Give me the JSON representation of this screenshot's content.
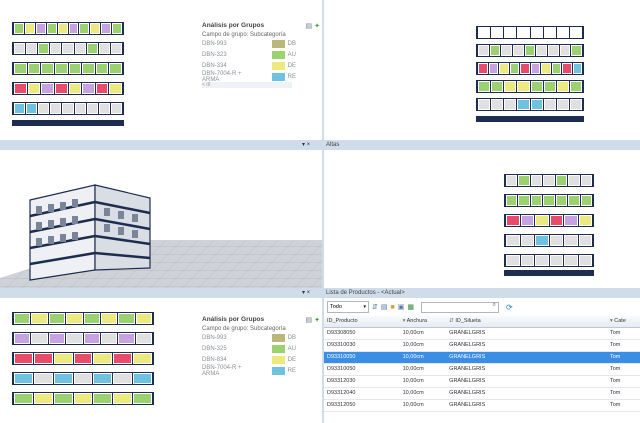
{
  "legend": {
    "title": "Análisis por Grupos",
    "subtitle": "Campo de grupo: Subcategoría",
    "items": [
      {
        "name": "DBN-993",
        "color": "#b9b77a",
        "code": "DB"
      },
      {
        "name": "DBN-323",
        "color": "#9bd16f",
        "code": "AU"
      },
      {
        "name": "DBN-334",
        "color": "#ecea7e",
        "code": "DE"
      },
      {
        "name": "DBN-7004-R + ARMA",
        "color": "#6fc1e0",
        "code": "RE"
      }
    ],
    "footer": "< III"
  },
  "legend_bottom": {
    "title": "Análisis por Grupos",
    "subtitle": "Campo de grupo: Subcategoría",
    "items": [
      {
        "name": "DBN-993",
        "color": "#b9b77a",
        "code": "DB"
      },
      {
        "name": "DBN-325",
        "color": "#9bd16f",
        "code": "AU"
      },
      {
        "name": "DBN-834",
        "color": "#ecea7e",
        "code": "DE"
      },
      {
        "name": "DBN-7004-R + ARMA",
        "color": "#6fc1e0",
        "code": "RE"
      }
    ]
  },
  "panel_alta": {
    "title": "Altas"
  },
  "product_list": {
    "title": "Lista de Productos - <Actual>",
    "filter_value": "Todo",
    "columns": [
      "ID_Producto",
      "Anchura",
      "ID_Silueta",
      "Cate"
    ],
    "rows": [
      [
        "D93308050",
        "10,00cm",
        "GRANELGRIS",
        "Tom"
      ],
      [
        "D93310030",
        "10,00cm",
        "GRANELGRIS",
        "Tom"
      ],
      [
        "D93310050",
        "10,00cm",
        "GRANELGRIS",
        "Tom"
      ],
      [
        "D93310050",
        "10,00cm",
        "GRANELGRIS",
        "Tom"
      ],
      [
        "D93312030",
        "10,00cm",
        "GRANELGRIS",
        "Tom"
      ],
      [
        "D93312040",
        "10,00cm",
        "GRANELGRIS",
        "Tom"
      ],
      [
        "D93312050",
        "10,00cm",
        "GRANELGRIS",
        "Tom"
      ]
    ],
    "selected_row": 2
  },
  "colors": {
    "fixture_navy": "#1e2d4f",
    "selection": "#3a8ee6",
    "splitter": "#cfdcea"
  }
}
